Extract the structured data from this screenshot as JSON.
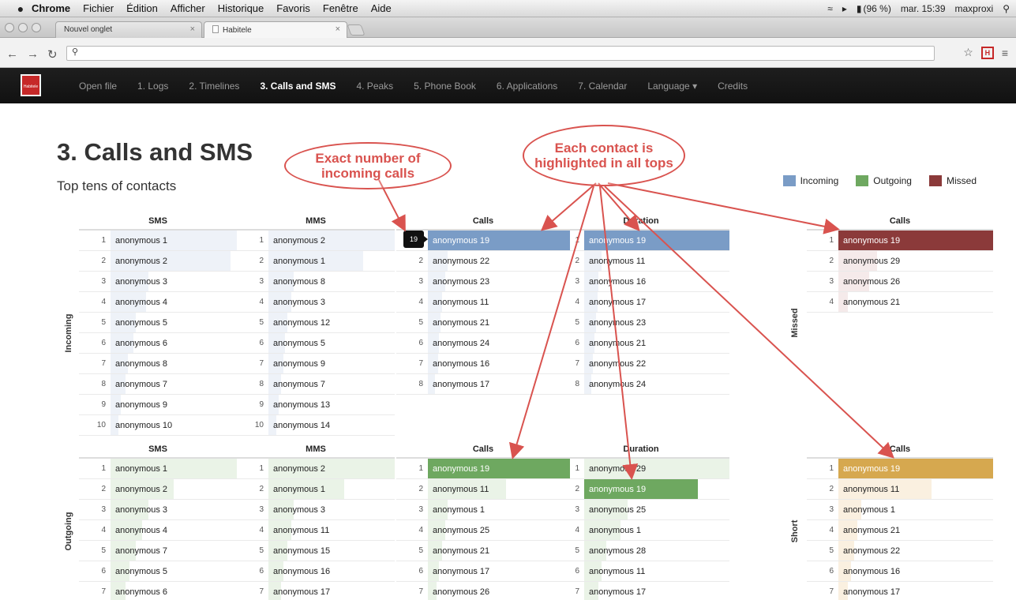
{
  "menubar": {
    "items": [
      "Chrome",
      "Fichier",
      "Édition",
      "Afficher",
      "Historique",
      "Favoris",
      "Fenêtre",
      "Aide"
    ],
    "battery": "(96 %)",
    "clock": "mar. 15:39",
    "user": "maxproxi"
  },
  "tabs": [
    {
      "label": "Nouvel onglet"
    },
    {
      "label": "Habitele"
    }
  ],
  "app": {
    "logo_text": "Habitele",
    "nav": [
      "Open file",
      "1. Logs",
      "2. Timelines",
      "3. Calls and SMS",
      "4. Peaks",
      "5. Phone Book",
      "6. Applications",
      "7. Calendar",
      "Language ▾",
      "Credits"
    ],
    "active_index": 3
  },
  "page": {
    "title": "3. Calls and SMS",
    "subtitle": "Top tens of contacts"
  },
  "legend": [
    {
      "label": "Incoming",
      "color": "#7a9cc6"
    },
    {
      "label": "Outgoing",
      "color": "#6ea860"
    },
    {
      "label": "Missed",
      "color": "#8b3a3a"
    }
  ],
  "colors": {
    "incoming": "#7a9cc6",
    "incoming_light": "#eef2f8",
    "outgoing": "#6ea860",
    "outgoing_light": "#eaf3e7",
    "outgoing_mid": "#9bc28f",
    "missed": "#8b3a3a",
    "missed_light": "#f5eaea",
    "short": "#d6a84f",
    "short_light": "#faf0e0"
  },
  "section_labels": {
    "incoming": "Incoming",
    "outgoing": "Outgoing",
    "missed": "Missed",
    "short": "Short"
  },
  "tooltip": "19",
  "tables": {
    "incoming": {
      "sms": {
        "header": "SMS",
        "rows": [
          {
            "r": "1",
            "name": "anonymous 1",
            "v": 1.0
          },
          {
            "r": "2",
            "name": "anonymous 2",
            "v": 0.95
          },
          {
            "r": "3",
            "name": "anonymous 3",
            "v": 0.3
          },
          {
            "r": "4",
            "name": "anonymous 4",
            "v": 0.28
          },
          {
            "r": "5",
            "name": "anonymous 5",
            "v": 0.2
          },
          {
            "r": "6",
            "name": "anonymous 6",
            "v": 0.18
          },
          {
            "r": "7",
            "name": "anonymous 8",
            "v": 0.14
          },
          {
            "r": "8",
            "name": "anonymous 7",
            "v": 0.12
          },
          {
            "r": "9",
            "name": "anonymous 9",
            "v": 0.08
          },
          {
            "r": "10",
            "name": "anonymous 10",
            "v": 0.06
          }
        ]
      },
      "mms": {
        "header": "MMS",
        "rows": [
          {
            "r": "1",
            "name": "anonymous 2",
            "v": 1.0
          },
          {
            "r": "2",
            "name": "anonymous 1",
            "v": 0.75
          },
          {
            "r": "3",
            "name": "anonymous 8",
            "v": 0.2
          },
          {
            "r": "4",
            "name": "anonymous 3",
            "v": 0.18
          },
          {
            "r": "5",
            "name": "anonymous 12",
            "v": 0.15
          },
          {
            "r": "6",
            "name": "anonymous 5",
            "v": 0.13
          },
          {
            "r": "7",
            "name": "anonymous 9",
            "v": 0.12
          },
          {
            "r": "8",
            "name": "anonymous 7",
            "v": 0.1
          },
          {
            "r": "9",
            "name": "anonymous 13",
            "v": 0.08
          },
          {
            "r": "10",
            "name": "anonymous 14",
            "v": 0.06
          }
        ]
      },
      "calls": {
        "header": "Calls",
        "rows": [
          {
            "r": "1",
            "name": "anonymous 19",
            "v": 1.0,
            "hl": true
          },
          {
            "r": "2",
            "name": "anonymous 22",
            "v": 0.14
          },
          {
            "r": "3",
            "name": "anonymous 23",
            "v": 0.12
          },
          {
            "r": "4",
            "name": "anonymous 11",
            "v": 0.1
          },
          {
            "r": "5",
            "name": "anonymous 21",
            "v": 0.09
          },
          {
            "r": "6",
            "name": "anonymous 24",
            "v": 0.08
          },
          {
            "r": "7",
            "name": "anonymous 16",
            "v": 0.07
          },
          {
            "r": "8",
            "name": "anonymous 17",
            "v": 0.05
          }
        ]
      },
      "duration": {
        "header": "Duration",
        "rows": [
          {
            "r": "1",
            "name": "anonymous 19",
            "v": 1.0,
            "hl": true
          },
          {
            "r": "2",
            "name": "anonymous 11",
            "v": 0.12
          },
          {
            "r": "3",
            "name": "anonymous 16",
            "v": 0.1
          },
          {
            "r": "4",
            "name": "anonymous 17",
            "v": 0.09
          },
          {
            "r": "5",
            "name": "anonymous 23",
            "v": 0.08
          },
          {
            "r": "6",
            "name": "anonymous 21",
            "v": 0.07
          },
          {
            "r": "7",
            "name": "anonymous 22",
            "v": 0.06
          },
          {
            "r": "8",
            "name": "anonymous 24",
            "v": 0.05
          }
        ]
      }
    },
    "missed": {
      "calls": {
        "header": "Calls",
        "rows": [
          {
            "r": "1",
            "name": "anonymous 19",
            "v": 1.0,
            "hl": true
          },
          {
            "r": "2",
            "name": "anonymous 29",
            "v": 0.25
          },
          {
            "r": "3",
            "name": "anonymous 26",
            "v": 0.2
          },
          {
            "r": "4",
            "name": "anonymous 21",
            "v": 0.06
          }
        ]
      }
    },
    "outgoing": {
      "sms": {
        "header": "SMS",
        "rows": [
          {
            "r": "1",
            "name": "anonymous 1",
            "v": 1.0
          },
          {
            "r": "2",
            "name": "anonymous 2",
            "v": 0.5
          },
          {
            "r": "3",
            "name": "anonymous 3",
            "v": 0.3
          },
          {
            "r": "4",
            "name": "anonymous 4",
            "v": 0.25
          },
          {
            "r": "5",
            "name": "anonymous 7",
            "v": 0.2
          },
          {
            "r": "6",
            "name": "anonymous 5",
            "v": 0.15
          },
          {
            "r": "7",
            "name": "anonymous 6",
            "v": 0.12
          }
        ]
      },
      "mms": {
        "header": "MMS",
        "rows": [
          {
            "r": "1",
            "name": "anonymous 2",
            "v": 1.0
          },
          {
            "r": "2",
            "name": "anonymous 1",
            "v": 0.6
          },
          {
            "r": "3",
            "name": "anonymous 3",
            "v": 0.2
          },
          {
            "r": "4",
            "name": "anonymous 11",
            "v": 0.18
          },
          {
            "r": "5",
            "name": "anonymous 15",
            "v": 0.15
          },
          {
            "r": "6",
            "name": "anonymous 16",
            "v": 0.12
          },
          {
            "r": "7",
            "name": "anonymous 17",
            "v": 0.1
          }
        ]
      },
      "calls": {
        "header": "Calls",
        "rows": [
          {
            "r": "1",
            "name": "anonymous 19",
            "v": 1.0,
            "hl": true
          },
          {
            "r": "2",
            "name": "anonymous 11",
            "v": 0.55
          },
          {
            "r": "3",
            "name": "anonymous 1",
            "v": 0.14
          },
          {
            "r": "4",
            "name": "anonymous 25",
            "v": 0.12
          },
          {
            "r": "5",
            "name": "anonymous 21",
            "v": 0.1
          },
          {
            "r": "6",
            "name": "anonymous 17",
            "v": 0.08
          },
          {
            "r": "7",
            "name": "anonymous 26",
            "v": 0.06
          }
        ]
      },
      "duration": {
        "header": "Duration",
        "rows": [
          {
            "r": "1",
            "name": "anonymous 29",
            "v": 1.0
          },
          {
            "r": "2",
            "name": "anonymous 19",
            "v": 0.78,
            "hl": true
          },
          {
            "r": "3",
            "name": "anonymous 25",
            "v": 0.3
          },
          {
            "r": "4",
            "name": "anonymous 1",
            "v": 0.25
          },
          {
            "r": "5",
            "name": "anonymous 28",
            "v": 0.15
          },
          {
            "r": "6",
            "name": "anonymous 11",
            "v": 0.12
          },
          {
            "r": "7",
            "name": "anonymous 17",
            "v": 0.1
          }
        ]
      }
    },
    "short": {
      "calls": {
        "header": "Calls",
        "rows": [
          {
            "r": "1",
            "name": "anonymous 19",
            "v": 1.0,
            "hl": true
          },
          {
            "r": "2",
            "name": "anonymous 11",
            "v": 0.6
          },
          {
            "r": "3",
            "name": "anonymous 1",
            "v": 0.15
          },
          {
            "r": "4",
            "name": "anonymous 21",
            "v": 0.12
          },
          {
            "r": "5",
            "name": "anonymous 22",
            "v": 0.1
          },
          {
            "r": "6",
            "name": "anonymous 16",
            "v": 0.08
          },
          {
            "r": "7",
            "name": "anonymous 17",
            "v": 0.06
          }
        ]
      }
    }
  },
  "annotations": [
    {
      "text": "Exact number of incoming calls"
    },
    {
      "text": "Each contact is highlighted in all tops"
    }
  ]
}
